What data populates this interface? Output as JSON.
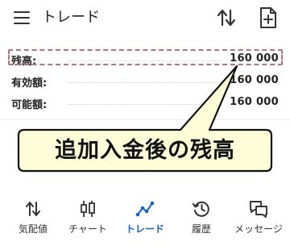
{
  "header": {
    "title": "トレード",
    "menu_icon": "hamburger-menu-icon",
    "sort_icon": "sort-up-down-icon",
    "new_doc_icon": "add-document-icon"
  },
  "account": {
    "rows": [
      {
        "label": "残高:",
        "value": "160 000"
      },
      {
        "label": "有効額:",
        "value": "160 000"
      },
      {
        "label": "可能額:",
        "value": "160 000"
      }
    ]
  },
  "annotation": {
    "text": "追加入金後の残高",
    "highlight_color": "#b5747d",
    "callout_fill": "#fdfdd8"
  },
  "bottom_nav": {
    "items": [
      {
        "label": "気配値",
        "icon": "quotes-arrows-icon"
      },
      {
        "label": "チャート",
        "icon": "candlestick-chart-icon"
      },
      {
        "label": "トレード",
        "icon": "trade-line-icon",
        "active": true
      },
      {
        "label": "履歴",
        "icon": "history-clock-icon"
      },
      {
        "label": "メッセージ",
        "icon": "messages-icon"
      }
    ],
    "active_color": "#1565c0"
  }
}
